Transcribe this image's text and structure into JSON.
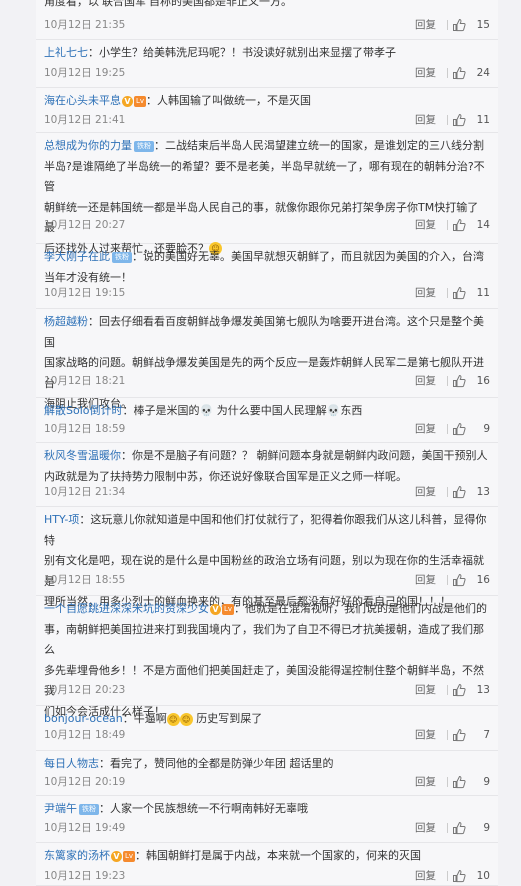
{
  "reply_label": "回复",
  "comments": [
    {
      "lines": [
        "角度看，以'联合国军'自称的美国都是非正义一方。"
      ],
      "time": "10月12日 21:35",
      "likes": "15"
    },
    {
      "user": "上礼七七",
      "lines": [
        "：小学生？给美韩洗尼玛呢？！书没读好就别出来显摆了带孝子"
      ],
      "time": "10月12日 19:25",
      "likes": "24"
    },
    {
      "user": "海在心头未平息",
      "badges": [
        "V",
        "Lv"
      ],
      "lines": [
        "：人韩国输了叫做统一，不是灭国"
      ],
      "time": "10月12日 21:41",
      "likes": "11"
    },
    {
      "user": "总想成为你的力量",
      "badges": [
        "铁粉"
      ],
      "lines": [
        "：二战结束后半岛人民渴望建立统一的国家，是谁划定的三八线分割",
        "半岛?是谁隔绝了半岛统一的希望？要不是老美，半岛早就统一了，哪有现在的朝韩分治?不管",
        "朝鲜统一还是韩国统一都是半岛人民自己的事，就像你跟你兄弟打架争房子你TM快打输了最",
        "后还找外人过来帮忙，还要脸不？"
      ],
      "emoji_end": true,
      "time": "10月12日 20:27",
      "likes": "14"
    },
    {
      "user": "李大刚子在此",
      "badges": [
        "铁粉"
      ],
      "lines": [
        "：说的美国好无辜。美国早就想灭朝鲜了，而且就因为美国的介入，台湾",
        "当年才没有统一！"
      ],
      "time": "10月12日 19:15",
      "likes": "11"
    },
    {
      "user": "杨超越粉",
      "lines": [
        "：回去仔细看看百度朝鲜战争爆发美国第七舰队为啥要开进台湾。这个只是整个美国",
        "国家战略的问题。朝鲜战争爆发美国是先的两个反应一是轰炸朝鲜人民军二是第七舰队开进台",
        "海阻止我们攻台。"
      ],
      "time": "10月12日 18:21",
      "likes": "16"
    },
    {
      "user": "解散Solo倒计时",
      "lines": [
        "：棒子是米国的💀 为什么要中国人民理解💀东西"
      ],
      "time": "10月12日 18:59",
      "likes": "9"
    },
    {
      "user": "秋风冬雪温暖你",
      "lines": [
        "：你是不是脑子有问题？？ 朝鲜问题本身就是朝鲜内政问题，美国干预别人",
        "内政就是为了扶持势力限制中苏，你还说好像联合国军是正义之师一样呢。"
      ],
      "time": "10月12日 21:34",
      "likes": "13"
    },
    {
      "user": "HTY-项",
      "lines": [
        "：这玩意儿你就知道是中国和他们打仗就行了，犯得着你跟我们从这儿科普，显得你特",
        "别有文化是吧，现在说的是什么是中国粉丝的政治立场有问题，别以为现在你的生活幸福就是",
        "理所当然，用多少烈士的鲜血换来的，有的甚至最后都没有好好的看自己的国！！！"
      ],
      "time": "10月12日 18:55",
      "likes": "16"
    },
    {
      "user": "一个自愿跳进深深米坑的资深少女",
      "badges": [
        "V",
        "Lv"
      ],
      "lines": [
        "：他就是在混淆视听，我们说的是他们内战是他们的",
        "事，南朝鲜把美国拉进来打到我国境内了，我们为了自卫不得已才抗美援朝，造成了我们那么",
        "多先辈埋骨他乡！！不是方面他们把美国赶走了，美国没能得逞控制住整个朝鲜半岛，不然我",
        "们如今会活成什么样子！"
      ],
      "time": "10月12日 20:23",
      "likes": "13"
    },
    {
      "user": "bonjour-ocean",
      "lines": [
        "：牛逼啊"
      ],
      "emoji_mid": true,
      "tail": " 历史写到屎了",
      "time": "10月12日 18:49",
      "likes": "7"
    },
    {
      "user": "每日人物志",
      "lines": [
        "：看完了，赞同他的全都是防弹少年团 超话里的"
      ],
      "time": "10月12日 20:19",
      "likes": "9"
    },
    {
      "user": "尹端午",
      "badges": [
        "铁粉"
      ],
      "lines": [
        "：人家一个民族想统一不行啊南韩好无辜哦"
      ],
      "time": "10月12日 19:49",
      "likes": "9"
    },
    {
      "user": "东篱家的汤杯",
      "badges": [
        "V",
        "Lv"
      ],
      "lines": [
        "：韩国朝鲜打是属于内战，本来就一个国家的，何来的灭国"
      ],
      "time": "10月12日 19:23",
      "likes": "10"
    }
  ]
}
